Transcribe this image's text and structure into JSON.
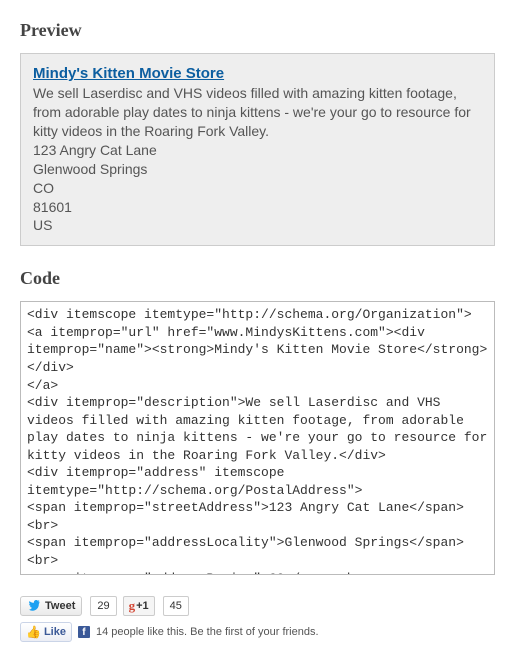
{
  "headings": {
    "preview": "Preview",
    "code": "Code"
  },
  "preview": {
    "link": "Mindy's Kitten Movie Store",
    "description": "We sell Laserdisc and VHS videos filled with amazing kitten footage, from adorable play dates to ninja kittens - we're your go to resource for kitty videos in the Roaring Fork Valley.",
    "street": "123 Angry Cat Lane",
    "city": "Glenwood Springs",
    "region": "CO",
    "postal": "81601",
    "country": "US"
  },
  "code": "<div itemscope itemtype=\"http://schema.org/Organization\">\n<a itemprop=\"url\" href=\"www.MindysKittens.com\"><div itemprop=\"name\"><strong>Mindy's Kitten Movie Store</strong></div>\n</a>\n<div itemprop=\"description\">We sell Laserdisc and VHS videos filled with amazing kitten footage, from adorable play dates to ninja kittens - we're your go to resource for kitty videos in the Roaring Fork Valley.</div>\n<div itemprop=\"address\" itemscope itemtype=\"http://schema.org/PostalAddress\">\n<span itemprop=\"streetAddress\">123 Angry Cat Lane</span><br>\n<span itemprop=\"addressLocality\">Glenwood Springs</span><br>\n<span itemprop=\"addressRegion\">CO</span><br>\n<span itemprop=\"postalCode\">81601</span><br>\n<span itemprop=\"addressCountry\">US</span><br>\n</div>",
  "share": {
    "tweet_label": "Tweet",
    "tweet_count": "29",
    "gplus_label": "+1",
    "gplus_count": "45",
    "like_label": "Like",
    "like_message": "14 people like this. Be the first of your friends."
  }
}
